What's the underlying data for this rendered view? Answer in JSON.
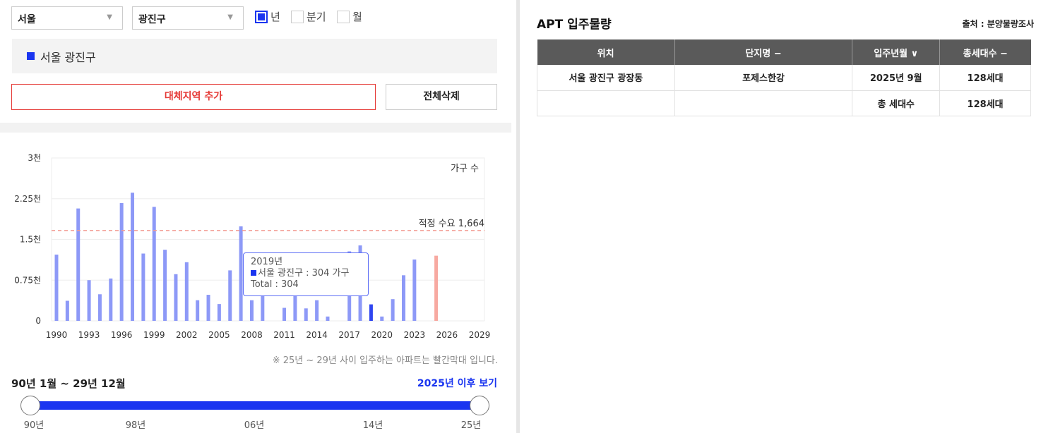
{
  "filters": {
    "city": "서울",
    "district": "광진구",
    "periods": [
      {
        "label": "년",
        "checked": true
      },
      {
        "label": "분기",
        "checked": false
      },
      {
        "label": "월",
        "checked": false
      }
    ]
  },
  "region_tag": "서울 광진구",
  "buttons": {
    "add_region": "대체지역 추가",
    "clear_all": "전체삭제"
  },
  "chart_data": {
    "type": "bar",
    "unit_label": "가구 수",
    "y_ticks": [
      "0",
      "0.75천",
      "1.5천",
      "2.25천",
      "3천"
    ],
    "ylim": [
      0,
      3000
    ],
    "x_ticks": [
      "1990",
      "1993",
      "1996",
      "1999",
      "2002",
      "2005",
      "2008",
      "2011",
      "2014",
      "2017",
      "2020",
      "2023",
      "2026",
      "2029"
    ],
    "xlim": [
      1990,
      2029
    ],
    "reference_line": {
      "label": "적정 수요 1,664",
      "value": 1664
    },
    "series": [
      {
        "name": "서울 광진구",
        "x": [
          1990,
          1991,
          1992,
          1993,
          1994,
          1995,
          1996,
          1997,
          1998,
          1999,
          2000,
          2001,
          2002,
          2003,
          2004,
          2005,
          2006,
          2007,
          2008,
          2009,
          2010,
          2011,
          2012,
          2013,
          2014,
          2015,
          2016,
          2017,
          2018,
          2019,
          2020,
          2021,
          2022,
          2023,
          2024,
          2025
        ],
        "values": [
          1220,
          370,
          2070,
          750,
          490,
          780,
          2170,
          2360,
          1240,
          2100,
          1310,
          860,
          1080,
          380,
          480,
          310,
          930,
          1740,
          380,
          560,
          0,
          240,
          640,
          230,
          380,
          80,
          0,
          1280,
          1390,
          304,
          80,
          400,
          840,
          1130,
          0,
          1200
        ],
        "highlight_year": 2019,
        "future_from": 2025
      }
    ],
    "colors": {
      "bar": "#8d99f7",
      "highlight": "#2f45f0",
      "future": "#f7a9a1",
      "ref_line": "#f29a90"
    },
    "grid": true
  },
  "tooltip": {
    "year": "2019년",
    "series_line": "서울 광진구 : 304 가구",
    "total_line": "Total : 304"
  },
  "note": "※ 25년 ~ 29년 사이 입주하는 아파트는 빨간막대 입니다.",
  "range": {
    "label": "90년 1월 ~ 29년 12월",
    "after_link": "2025년 이후 보기",
    "ticks": [
      "90년",
      "98년",
      "06년",
      "14년",
      "25년"
    ]
  },
  "right_panel": {
    "title": "APT 입주물량",
    "source": "출처 : 분양물량조사",
    "columns": [
      "위치",
      "단지명 −",
      "입주년월 ∨",
      "총세대수 −"
    ],
    "rows": [
      [
        "서울 광진구 광장동",
        "포제스한강",
        "2025년 9월",
        "128세대"
      ],
      [
        "",
        "",
        "총 세대수",
        "128세대"
      ]
    ]
  }
}
